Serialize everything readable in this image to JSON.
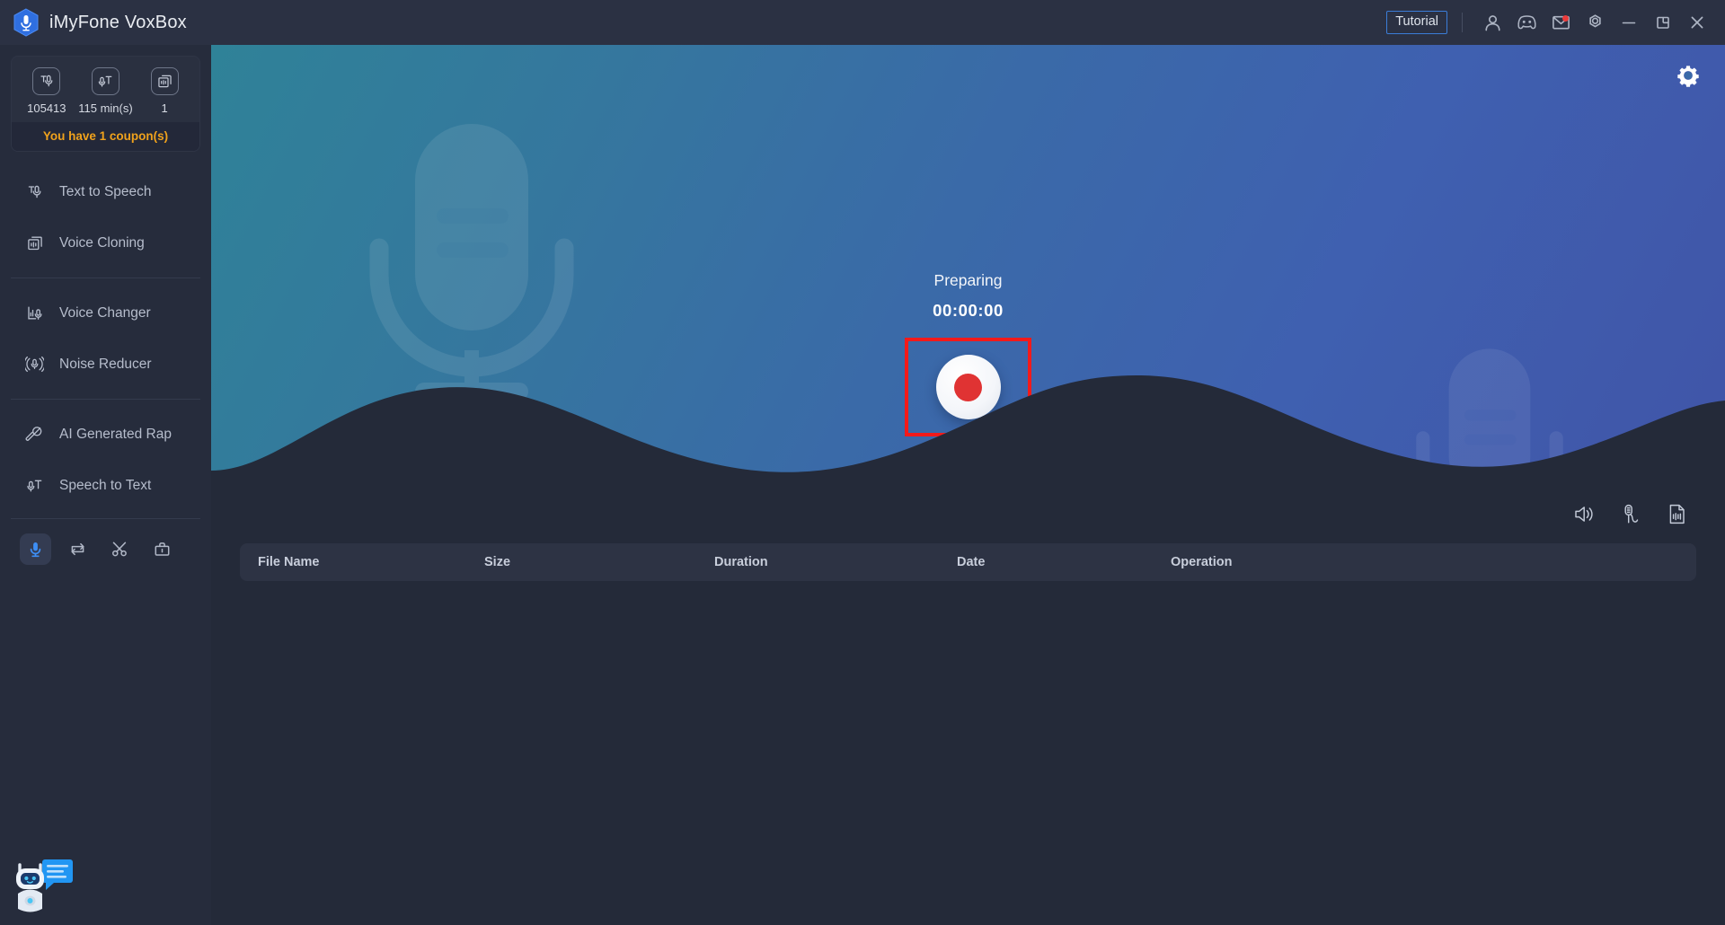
{
  "window": {
    "app_title": "iMyFone VoxBox",
    "logo_icon": "mic-hexagon-logo",
    "tutorial_label": "Tutorial",
    "icons": [
      {
        "name": "account-icon",
        "glyph": "person"
      },
      {
        "name": "discord-icon",
        "glyph": "game-controller"
      },
      {
        "name": "mail-icon",
        "glyph": "envelope",
        "badge": true
      },
      {
        "name": "settings-icon",
        "glyph": "gear-hex"
      },
      {
        "name": "minimize-button",
        "glyph": "minimize"
      },
      {
        "name": "maximize-button",
        "glyph": "maximize"
      },
      {
        "name": "close-button",
        "glyph": "close"
      }
    ]
  },
  "sidebar": {
    "credits": [
      {
        "icon": "text-to-speech-icon",
        "value": "105413"
      },
      {
        "icon": "speech-to-text-icon",
        "value": "115 min(s)"
      },
      {
        "icon": "voice-cloning-icon",
        "value": "1"
      }
    ],
    "coupon_text": "You have 1 coupon(s)",
    "coupon_color": "#f0a21c",
    "groups": [
      {
        "items": [
          {
            "label": "Text to Speech",
            "icon": "text-to-speech-icon"
          },
          {
            "label": "Voice Cloning",
            "icon": "voice-cloning-icon"
          }
        ]
      },
      {
        "items": [
          {
            "label": "Voice Changer",
            "icon": "voice-changer-icon"
          },
          {
            "label": "Noise Reducer",
            "icon": "noise-reducer-icon"
          }
        ]
      },
      {
        "items": [
          {
            "label": "AI Generated Rap",
            "icon": "ai-rap-icon"
          },
          {
            "label": "Speech to Text",
            "icon": "speech-to-text-icon"
          }
        ]
      }
    ],
    "tools": [
      {
        "name": "recorder-tool",
        "icon": "microphone-icon",
        "active": true
      },
      {
        "name": "converter-tool",
        "icon": "loop-convert-icon",
        "active": false
      },
      {
        "name": "cutter-tool",
        "icon": "scissors-icon",
        "active": false
      },
      {
        "name": "toolbox-tool",
        "icon": "toolbox-icon",
        "active": false
      }
    ],
    "chatbot_icon": "chatbot-mascot-icon",
    "active_tool_color": "#3d8ef5"
  },
  "hero": {
    "settings_icon": "gear-icon",
    "status_label": "Preparing",
    "timer": "00:00:00",
    "record_button": {
      "name": "record-button",
      "dot_color": "#e03333",
      "highlight_color": "#f31a1a"
    },
    "watermark_icon": "microphone-watermark"
  },
  "file_list": {
    "toolbar_icons": [
      {
        "name": "system-sound-icon",
        "glyph": "speaker"
      },
      {
        "name": "microphone-input-icon",
        "glyph": "mic-wave"
      },
      {
        "name": "audio-file-icon",
        "glyph": "file-wave"
      }
    ],
    "columns": [
      "File Name",
      "Size",
      "Duration",
      "Date",
      "Operation"
    ],
    "rows": []
  }
}
